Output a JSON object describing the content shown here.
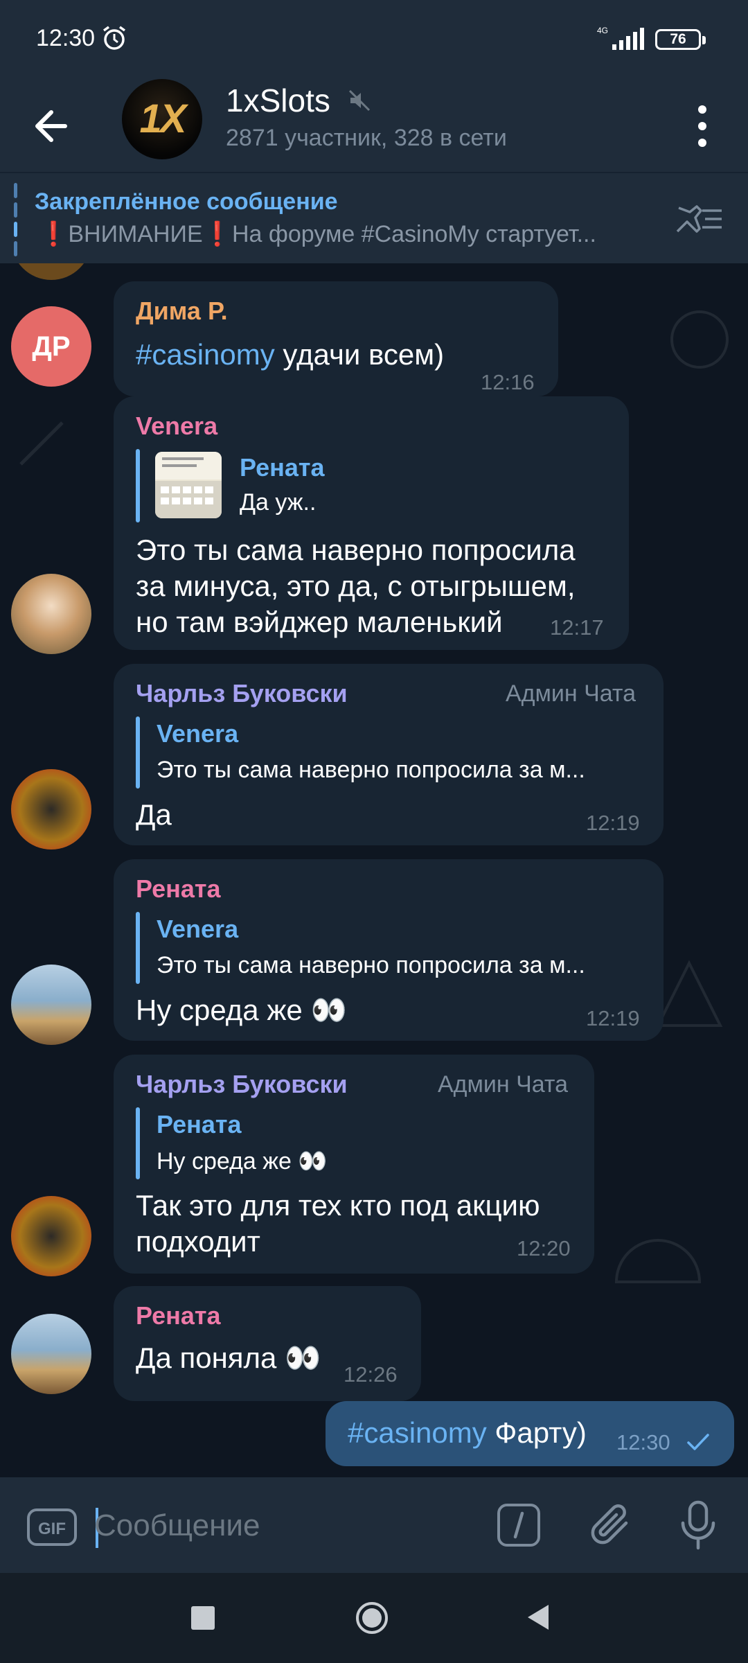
{
  "status_bar": {
    "time": "12:30",
    "network": "4G",
    "battery": "76"
  },
  "header": {
    "title": "1xSlots",
    "subtitle": "2871 участник, 328 в сети",
    "avatar_text": "1X"
  },
  "pinned": {
    "title": "Закреплённое сообщение",
    "text": "❗ВНИМАНИЕ❗На форуме #CasinoMy стартует..."
  },
  "messages": [
    {
      "sender": "Дима Р.",
      "sender_color": "#f0a664",
      "avatar_initials": "ДР",
      "avatar_color": "#e56a68",
      "hashtag": "#casinomy",
      "text": " удачи всем)",
      "time": "12:16"
    },
    {
      "sender": "Venera",
      "sender_color": "#ee7aa8",
      "reply_name": "Рената",
      "reply_text": "Да уж..",
      "text_lines": [
        "Это ты сама наверно попросила",
        "за минуса, это да, с отыгрышем,",
        "но там вэйджер маленький"
      ],
      "time": "12:17"
    },
    {
      "sender": "Чарльз Буковски",
      "sender_color": "#a4a0f0",
      "admin": "Админ Чата",
      "reply_name": "Venera",
      "reply_text": "Это ты сама наверно попросила за м...",
      "text": "Да",
      "time": "12:19"
    },
    {
      "sender": "Рената",
      "sender_color": "#ee7aa8",
      "reply_name": "Venera",
      "reply_text": "Это ты сама наверно попросила за м...",
      "text": "Ну среда же 👀",
      "time": "12:19"
    },
    {
      "sender": "Чарльз Буковски",
      "sender_color": "#a4a0f0",
      "admin": "Админ Чата",
      "reply_name": "Рената",
      "reply_text": "Ну среда же 👀",
      "text_lines": [
        "Так это для тех кто под акцию",
        "подходит"
      ],
      "time": "12:20"
    },
    {
      "sender": "Рената",
      "sender_color": "#ee7aa8",
      "text": "Да поняла 👀",
      "time": "12:26"
    }
  ],
  "outgoing": {
    "hashtag": "#casinomy",
    "text": " Фарту)",
    "time": "12:30"
  },
  "input": {
    "placeholder": "Сообщение"
  },
  "colors": {
    "accent": "#6ab3f3",
    "background": "#0e1621",
    "bar": "#1f2c3a",
    "incoming_bubble": "#182533",
    "outgoing_bubble": "#2b5278"
  }
}
